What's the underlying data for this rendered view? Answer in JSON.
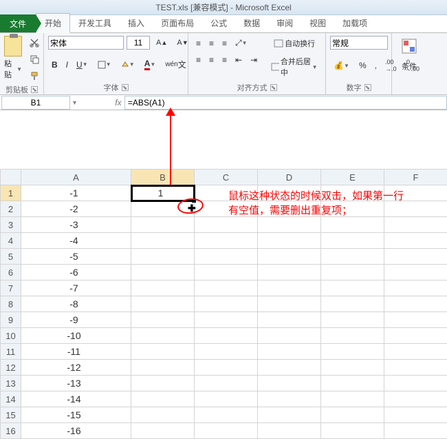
{
  "title": "TEST.xls [兼容模式] - Microsoft Excel",
  "tabs": {
    "file": "文件",
    "items": [
      "开始",
      "开发工具",
      "插入",
      "页面布局",
      "公式",
      "数据",
      "审阅",
      "视图",
      "加载项"
    ],
    "active_index": 0
  },
  "ribbon": {
    "clipboard": {
      "paste": "粘贴",
      "label": "剪贴板"
    },
    "font": {
      "name": "宋体",
      "size": "11",
      "label": "字体"
    },
    "alignment": {
      "wrap": "自动换行",
      "merge": "合并后居中",
      "label": "对齐方式"
    },
    "number": {
      "format": "常规",
      "label": "数字"
    },
    "style": {
      "cond": "条件"
    }
  },
  "namebox": "B1",
  "formula": "=ABS(A1)",
  "columns": [
    "A",
    "B",
    "C",
    "D",
    "E",
    "F"
  ],
  "selected_col": "B",
  "selected_row": 1,
  "rows": [
    {
      "n": 1,
      "a": "-1",
      "b": "1"
    },
    {
      "n": 2,
      "a": "-2",
      "b": ""
    },
    {
      "n": 3,
      "a": "-3",
      "b": ""
    },
    {
      "n": 4,
      "a": "-4",
      "b": ""
    },
    {
      "n": 5,
      "a": "-5",
      "b": ""
    },
    {
      "n": 6,
      "a": "-6",
      "b": ""
    },
    {
      "n": 7,
      "a": "-7",
      "b": ""
    },
    {
      "n": 8,
      "a": "-8",
      "b": ""
    },
    {
      "n": 9,
      "a": "-9",
      "b": ""
    },
    {
      "n": 10,
      "a": "-10",
      "b": ""
    },
    {
      "n": 11,
      "a": "-11",
      "b": ""
    },
    {
      "n": 12,
      "a": "-12",
      "b": ""
    },
    {
      "n": 13,
      "a": "-13",
      "b": ""
    },
    {
      "n": 14,
      "a": "-14",
      "b": ""
    },
    {
      "n": 15,
      "a": "-15",
      "b": ""
    },
    {
      "n": 16,
      "a": "-16",
      "b": ""
    }
  ],
  "annotation": "鼠标这种状态的时候双击，如果第一行有空值，需要删出重复项；"
}
